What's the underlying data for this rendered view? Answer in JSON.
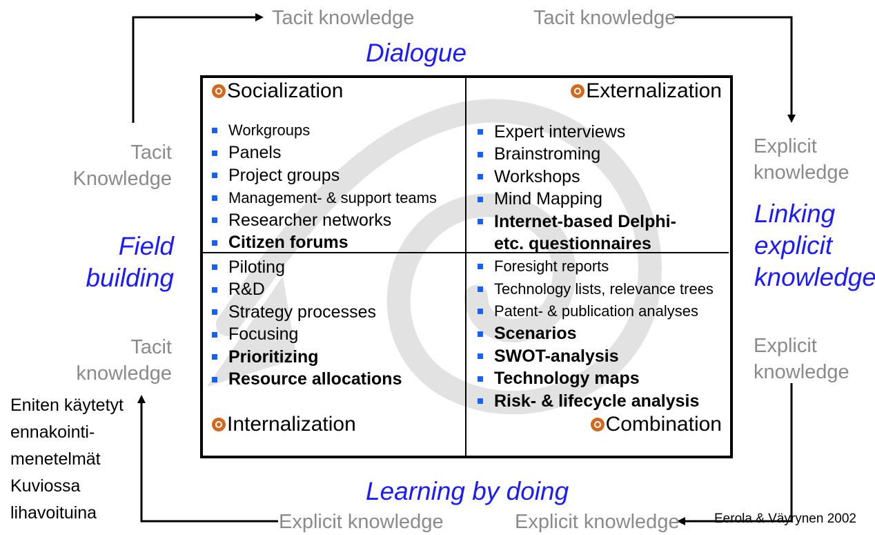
{
  "top_labels": {
    "left": "Tacit knowledge",
    "right": "Tacit knowledge"
  },
  "bottom_labels": {
    "left": "Explicit knowledge",
    "right": "Explicit knowledge"
  },
  "side_labels": {
    "left_top": [
      "Tacit",
      "Knowledge"
    ],
    "left_bottom": [
      "Tacit",
      "knowledge"
    ],
    "right_top": [
      "Explicit",
      "knowledge"
    ],
    "right_bottom": [
      "Explicit",
      "knowledge"
    ]
  },
  "modes": {
    "top": "Dialogue",
    "left": [
      "Field",
      "building"
    ],
    "right": [
      "Linking",
      "explicit",
      "knowledge"
    ],
    "bottom": "Learning by doing"
  },
  "quadrants": {
    "socialization": {
      "title": "Socialization",
      "items": [
        {
          "text": "Workgroups",
          "bold": false
        },
        {
          "text": "Panels",
          "bold": false
        },
        {
          "text": "Project groups",
          "bold": false
        },
        {
          "text": "Management- & support teams",
          "bold": false
        },
        {
          "text": "Researcher networks",
          "bold": false
        },
        {
          "text": "Citizen forums",
          "bold": true
        }
      ]
    },
    "externalization": {
      "title": "Externalization",
      "items": [
        {
          "text": "Expert interviews",
          "bold": false
        },
        {
          "text": "Brainstroming",
          "bold": false
        },
        {
          "text": "Workshops",
          "bold": false
        },
        {
          "text": "Mind Mapping",
          "bold": false
        },
        {
          "text": "Internet-based Delphi-",
          "bold": true
        },
        {
          "text": "etc. questionnaires",
          "bold": true
        }
      ]
    },
    "internalization": {
      "title": "Internalization",
      "items": [
        {
          "text": "Piloting",
          "bold": false
        },
        {
          "text": "R&D",
          "bold": false
        },
        {
          "text": "Strategy processes",
          "bold": false
        },
        {
          "text": "Focusing",
          "bold": false
        },
        {
          "text": "Prioritizing",
          "bold": true
        },
        {
          "text": "Resource allocations",
          "bold": true
        }
      ]
    },
    "combination": {
      "title": "Combination",
      "items": [
        {
          "text": "Foresight reports",
          "bold": false
        },
        {
          "text": "Technology lists, relevance trees",
          "bold": false
        },
        {
          "text": "Patent- & publication analyses",
          "bold": false
        },
        {
          "text": "Scenarios",
          "bold": true
        },
        {
          "text": "SWOT-analysis",
          "bold": true
        },
        {
          "text": "Technology maps",
          "bold": true
        },
        {
          "text": "Risk- & lifecycle analysis",
          "bold": true
        }
      ]
    }
  },
  "note": [
    "Eniten käytetyt",
    "ennakointi-",
    "menetelmät",
    "Kuviossa",
    "lihavoituina"
  ],
  "citation": "Eerola & Väyrynen 2002",
  "colors": {
    "blue_text": "#1a1aff",
    "gray_text": "#8a8a8a",
    "bullet": "#1560ff",
    "quadrant_icon": "#d2691e",
    "spiral": "#e2e2e2"
  }
}
